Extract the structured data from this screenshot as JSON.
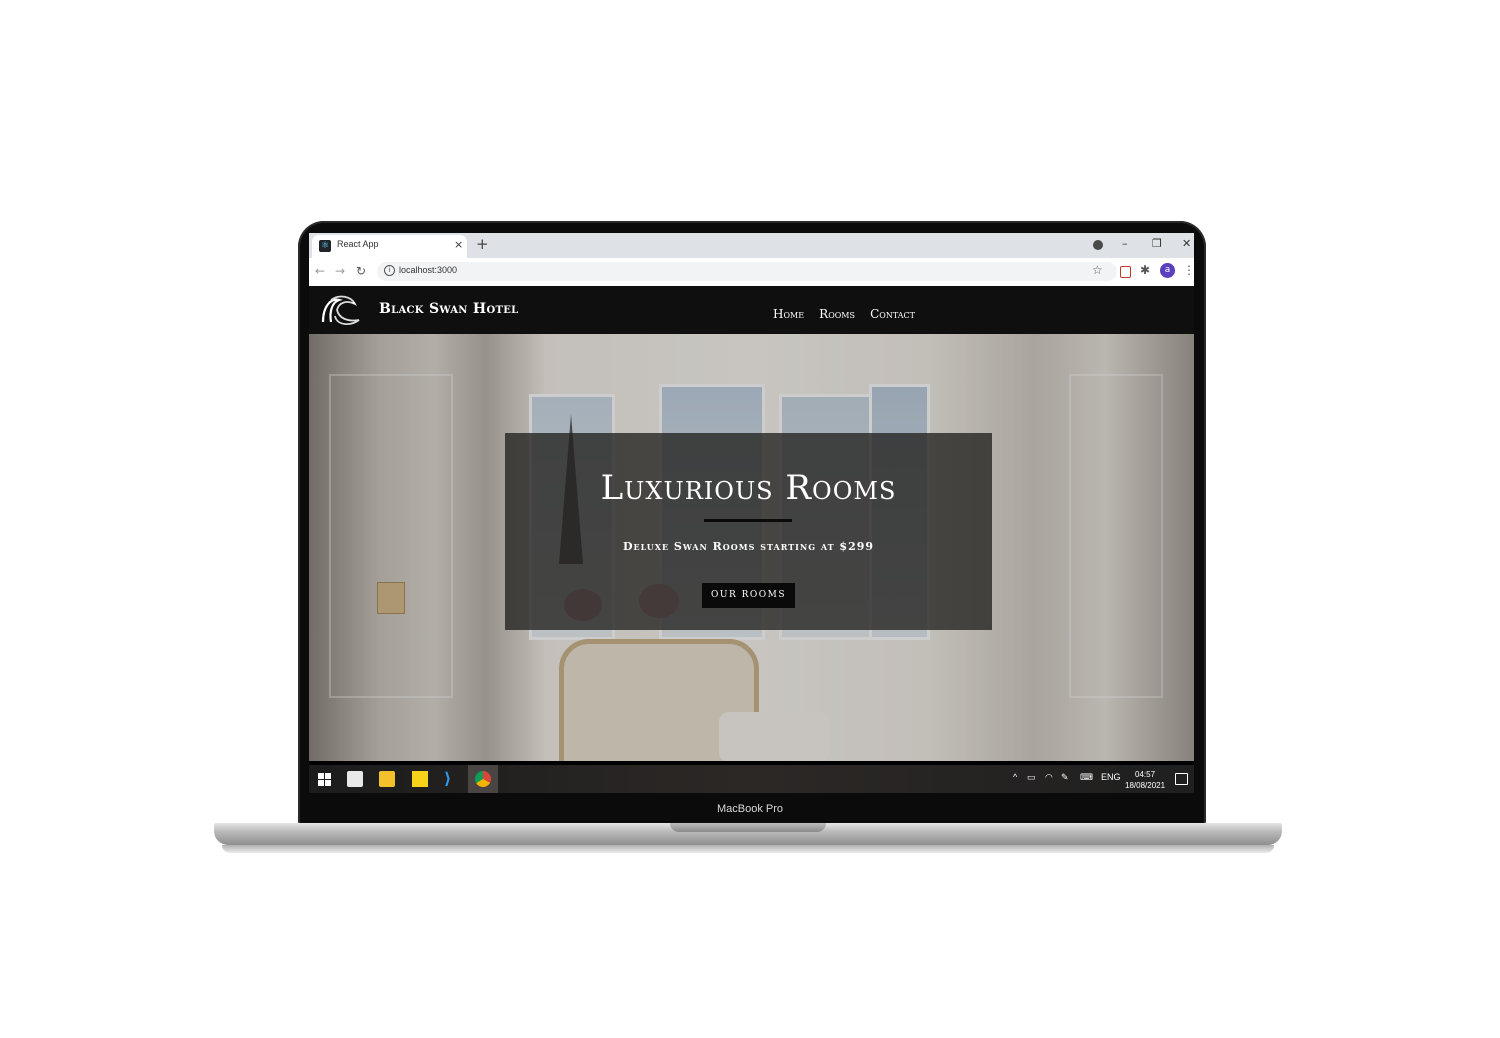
{
  "device": {
    "label": "MacBook Pro"
  },
  "browser": {
    "tab_title": "React App",
    "tab_close": "×",
    "new_tab": "+",
    "url": "localhost:3000",
    "avatar_letter": "a",
    "minimize": "–",
    "restore": "❐",
    "close": "✕"
  },
  "site": {
    "brand": "Black Swan Hotel",
    "nav": [
      {
        "label": "Home"
      },
      {
        "label": "Rooms"
      },
      {
        "label": "Contact"
      }
    ],
    "hero": {
      "title": "Luxurious Rooms",
      "subtitle": "Deluxe Swan Rooms starting at $299",
      "button_label": "OUR ROOMS"
    }
  },
  "taskbar": {
    "language": "ENG",
    "time": "04:57",
    "date": "18/08/2021"
  },
  "colors": {
    "nav_background": "#0f0f0f",
    "banner_background": "rgba(35,33,31,0.78)",
    "button_background": "#0a0a0a",
    "avatar": "#5b3fbf"
  }
}
